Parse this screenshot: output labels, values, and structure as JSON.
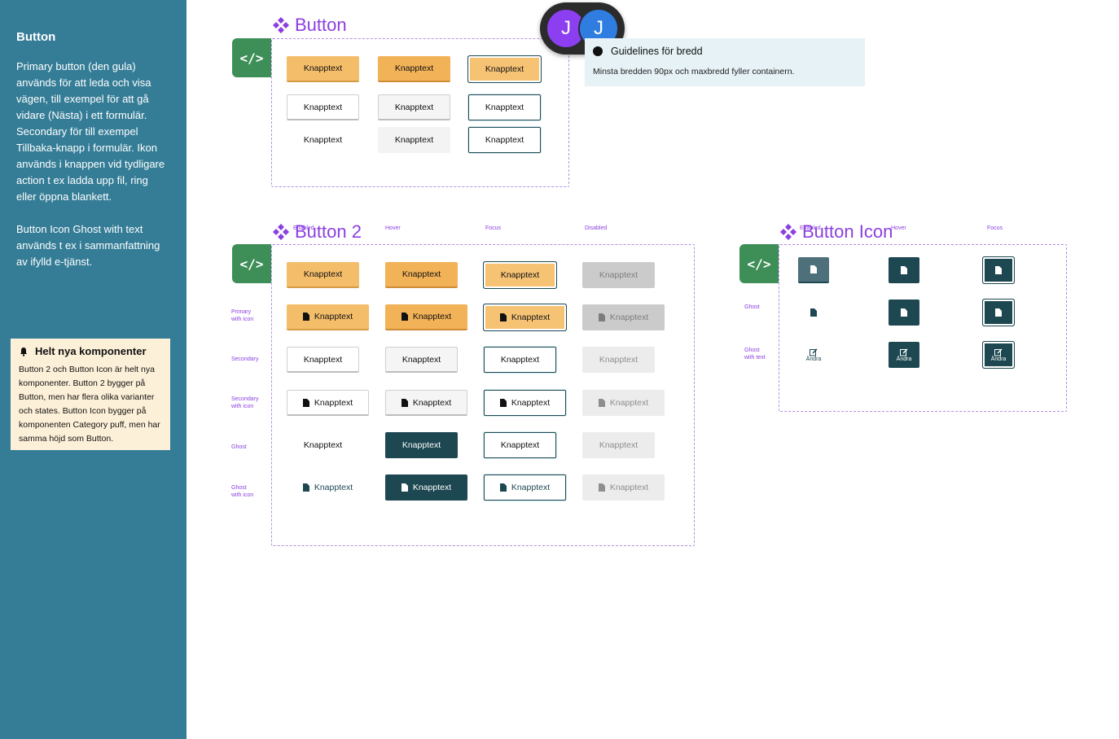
{
  "sidebar": {
    "title": "Button",
    "description": "Primary button (den gula) används för att leda och visa vägen, till exempel för att gå vidare (Nästa) i ett formulär. Secondary för till exempel Tillbaka-knapp i formulär. Ikon används i knappen vid tydligare action t ex ladda upp fil, ring eller öppna blankett.\n\nButton Icon Ghost with text används t ex i sammanfattning av ifylld e-tjänst.",
    "note": {
      "icon": "bell-icon",
      "title": "Helt nya komponenter",
      "body": "Button 2 och Button Icon är helt nya komponenter. Button 2 bygger på Button, men har flera olika varianter och states. Button Icon bygger på komponenten Category puff, men har samma höjd som Button."
    }
  },
  "sections": {
    "button": {
      "title": "Button",
      "code_icon": "code-icon"
    },
    "button2": {
      "title": "Button 2",
      "columns": [
        "Enabled",
        "Hover",
        "Focus",
        "Disabled"
      ],
      "rows": [
        "Primary\nwith icon",
        "Secondary",
        "Secondary\nwith icon",
        "Ghost",
        "Ghost\nwith icon"
      ]
    },
    "button_icon": {
      "title": "Button Icon",
      "columns": [
        "Enabled",
        "Hover",
        "Focus"
      ],
      "rows": [
        "Ghost",
        "Ghost\nwith text"
      ],
      "edit_label": "Ändra"
    }
  },
  "button_label": "Knapptext",
  "info": {
    "title": "Guidelines för bredd",
    "body": "Minsta bredden 90px och maxbredd fyller containern."
  },
  "avatars": [
    {
      "initial": "J",
      "color": "#8b3ff0"
    },
    {
      "initial": "J",
      "color": "#2f7de0"
    }
  ],
  "colors": {
    "sidebar": "#357d96",
    "primary": "#f4bd6a",
    "dark": "#1d4751",
    "accent": "#8b3fe0",
    "code_badge": "#3e8e58"
  }
}
